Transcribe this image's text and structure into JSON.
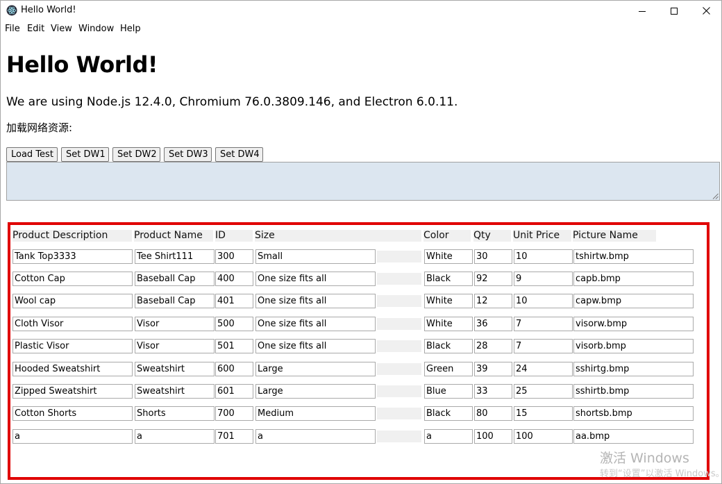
{
  "window": {
    "title": "Hello World!",
    "controls": {
      "minimize": "minimize-icon",
      "maximize": "maximize-icon",
      "close": "close-icon"
    }
  },
  "menu": [
    "File",
    "Edit",
    "View",
    "Window",
    "Help"
  ],
  "main": {
    "heading": "Hello World!",
    "versions": "We are using Node.js 12.4.0, Chromium 76.0.3809.146, and Electron 6.0.11.",
    "load_label": "加载网络资源:",
    "buttons": [
      "Load Test",
      "Set DW1",
      "Set DW2",
      "Set DW3",
      "Set DW4"
    ],
    "log_text": ""
  },
  "grid": {
    "columns": [
      "Product Description",
      "Product Name",
      "ID",
      "Size",
      "",
      "Color",
      "Qty",
      "Unit Price",
      "Picture Name"
    ],
    "rows": [
      [
        "Tank Top3333",
        "Tee Shirt111",
        "300",
        "Small",
        "White",
        "30",
        "10",
        "tshirtw.bmp"
      ],
      [
        "Cotton Cap",
        "Baseball Cap",
        "400",
        "One size fits all",
        "Black",
        "92",
        "9",
        "capb.bmp"
      ],
      [
        "Wool cap",
        "Baseball Cap",
        "401",
        "One size fits all",
        "White",
        "12",
        "10",
        "capw.bmp"
      ],
      [
        "Cloth Visor",
        "Visor",
        "500",
        "One size fits all",
        "White",
        "36",
        "7",
        "visorw.bmp"
      ],
      [
        "Plastic Visor",
        "Visor",
        "501",
        "One size fits all",
        "Black",
        "28",
        "7",
        "visorb.bmp"
      ],
      [
        "Hooded Sweatshirt",
        "Sweatshirt",
        "600",
        "Large",
        "Green",
        "39",
        "24",
        "sshirtg.bmp"
      ],
      [
        "Zipped Sweatshirt",
        "Sweatshirt",
        "601",
        "Large",
        "Blue",
        "33",
        "25",
        "sshirtb.bmp"
      ],
      [
        "Cotton Shorts",
        "Shorts",
        "700",
        "Medium",
        "Black",
        "80",
        "15",
        "shortsb.bmp"
      ],
      [
        "a",
        "a",
        "701",
        "a",
        "a",
        "100",
        "100",
        "aa.bmp"
      ]
    ],
    "highlight_color": "#e00000"
  },
  "watermark": {
    "line1": "激活 Windows",
    "line2": "转到“设置”以激活 Windows。"
  }
}
